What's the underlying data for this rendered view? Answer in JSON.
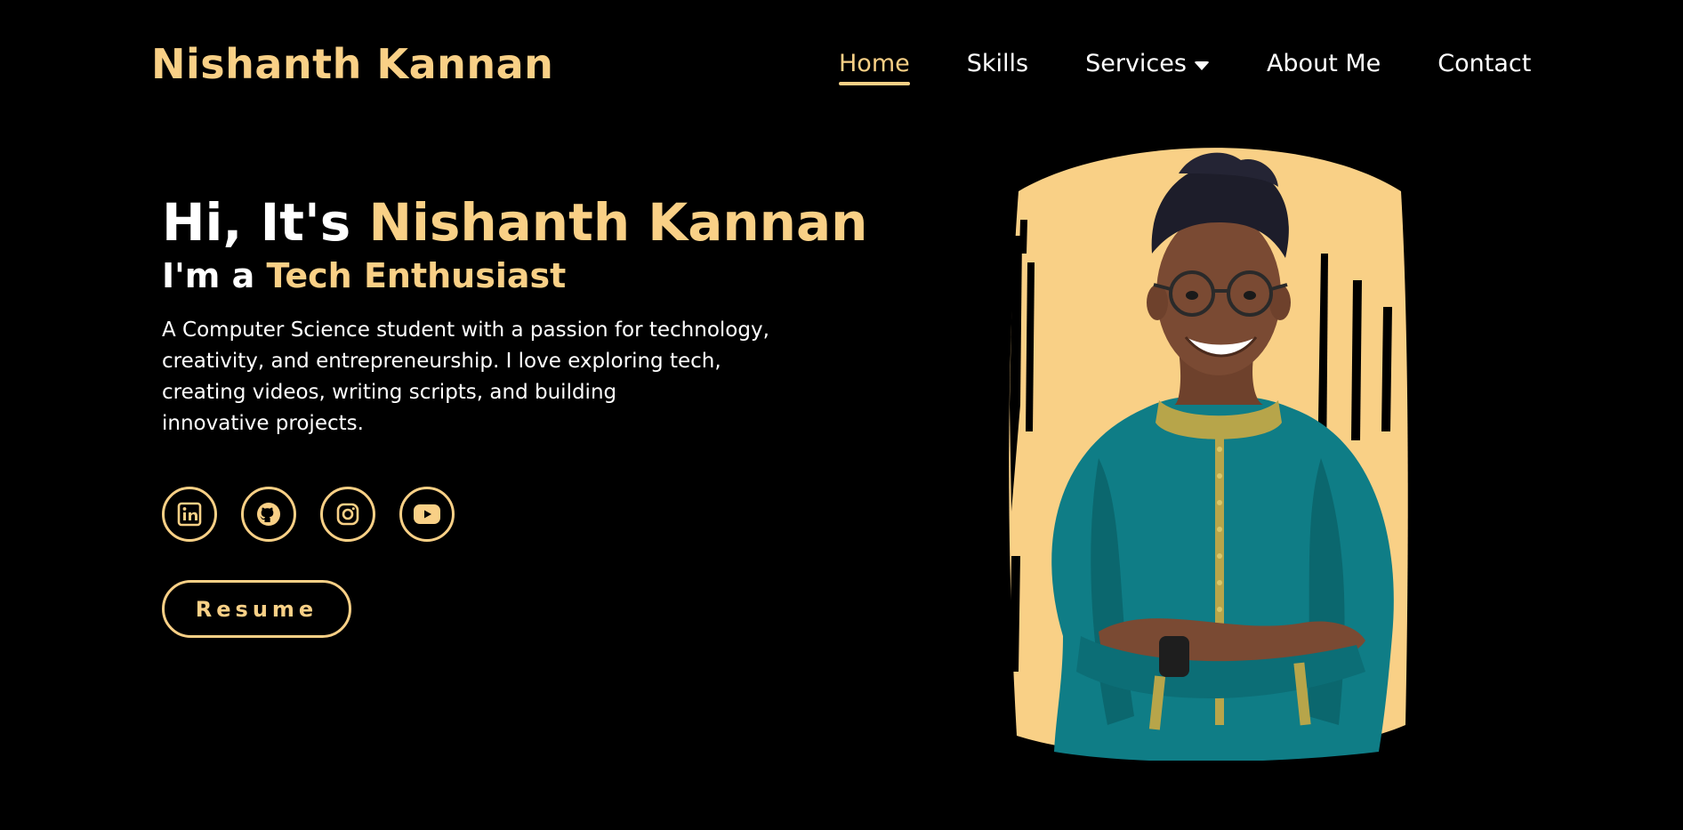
{
  "brand": {
    "name": "Nishanth Kannan"
  },
  "nav": {
    "items": [
      {
        "label": "Home",
        "active": true
      },
      {
        "label": "Skills"
      },
      {
        "label": "Services",
        "has_dropdown": true
      },
      {
        "label": "About Me"
      },
      {
        "label": "Contact"
      }
    ]
  },
  "hero": {
    "greeting_prefix": "Hi, It's",
    "greeting_name": "Nishanth Kannan",
    "role_prefix": "I'm a",
    "role": "Tech Enthusiast",
    "bio_lines": [
      "A Computer Science student with a passion for technology,",
      "creativity, and entrepreneurship. I love exploring tech,",
      "creating videos, writing scripts, and building",
      "innovative projects."
    ]
  },
  "socials": [
    {
      "icon": "linkedin-icon"
    },
    {
      "icon": "github-icon"
    },
    {
      "icon": "instagram-icon"
    },
    {
      "icon": "youtube-icon"
    }
  ],
  "resume": {
    "label": "Resume"
  },
  "portrait": {
    "description": "profile-photo"
  },
  "colors": {
    "background": "#000000",
    "accent": "#f9d086",
    "text": "#ffffff",
    "shirt": "#0f7d86"
  }
}
